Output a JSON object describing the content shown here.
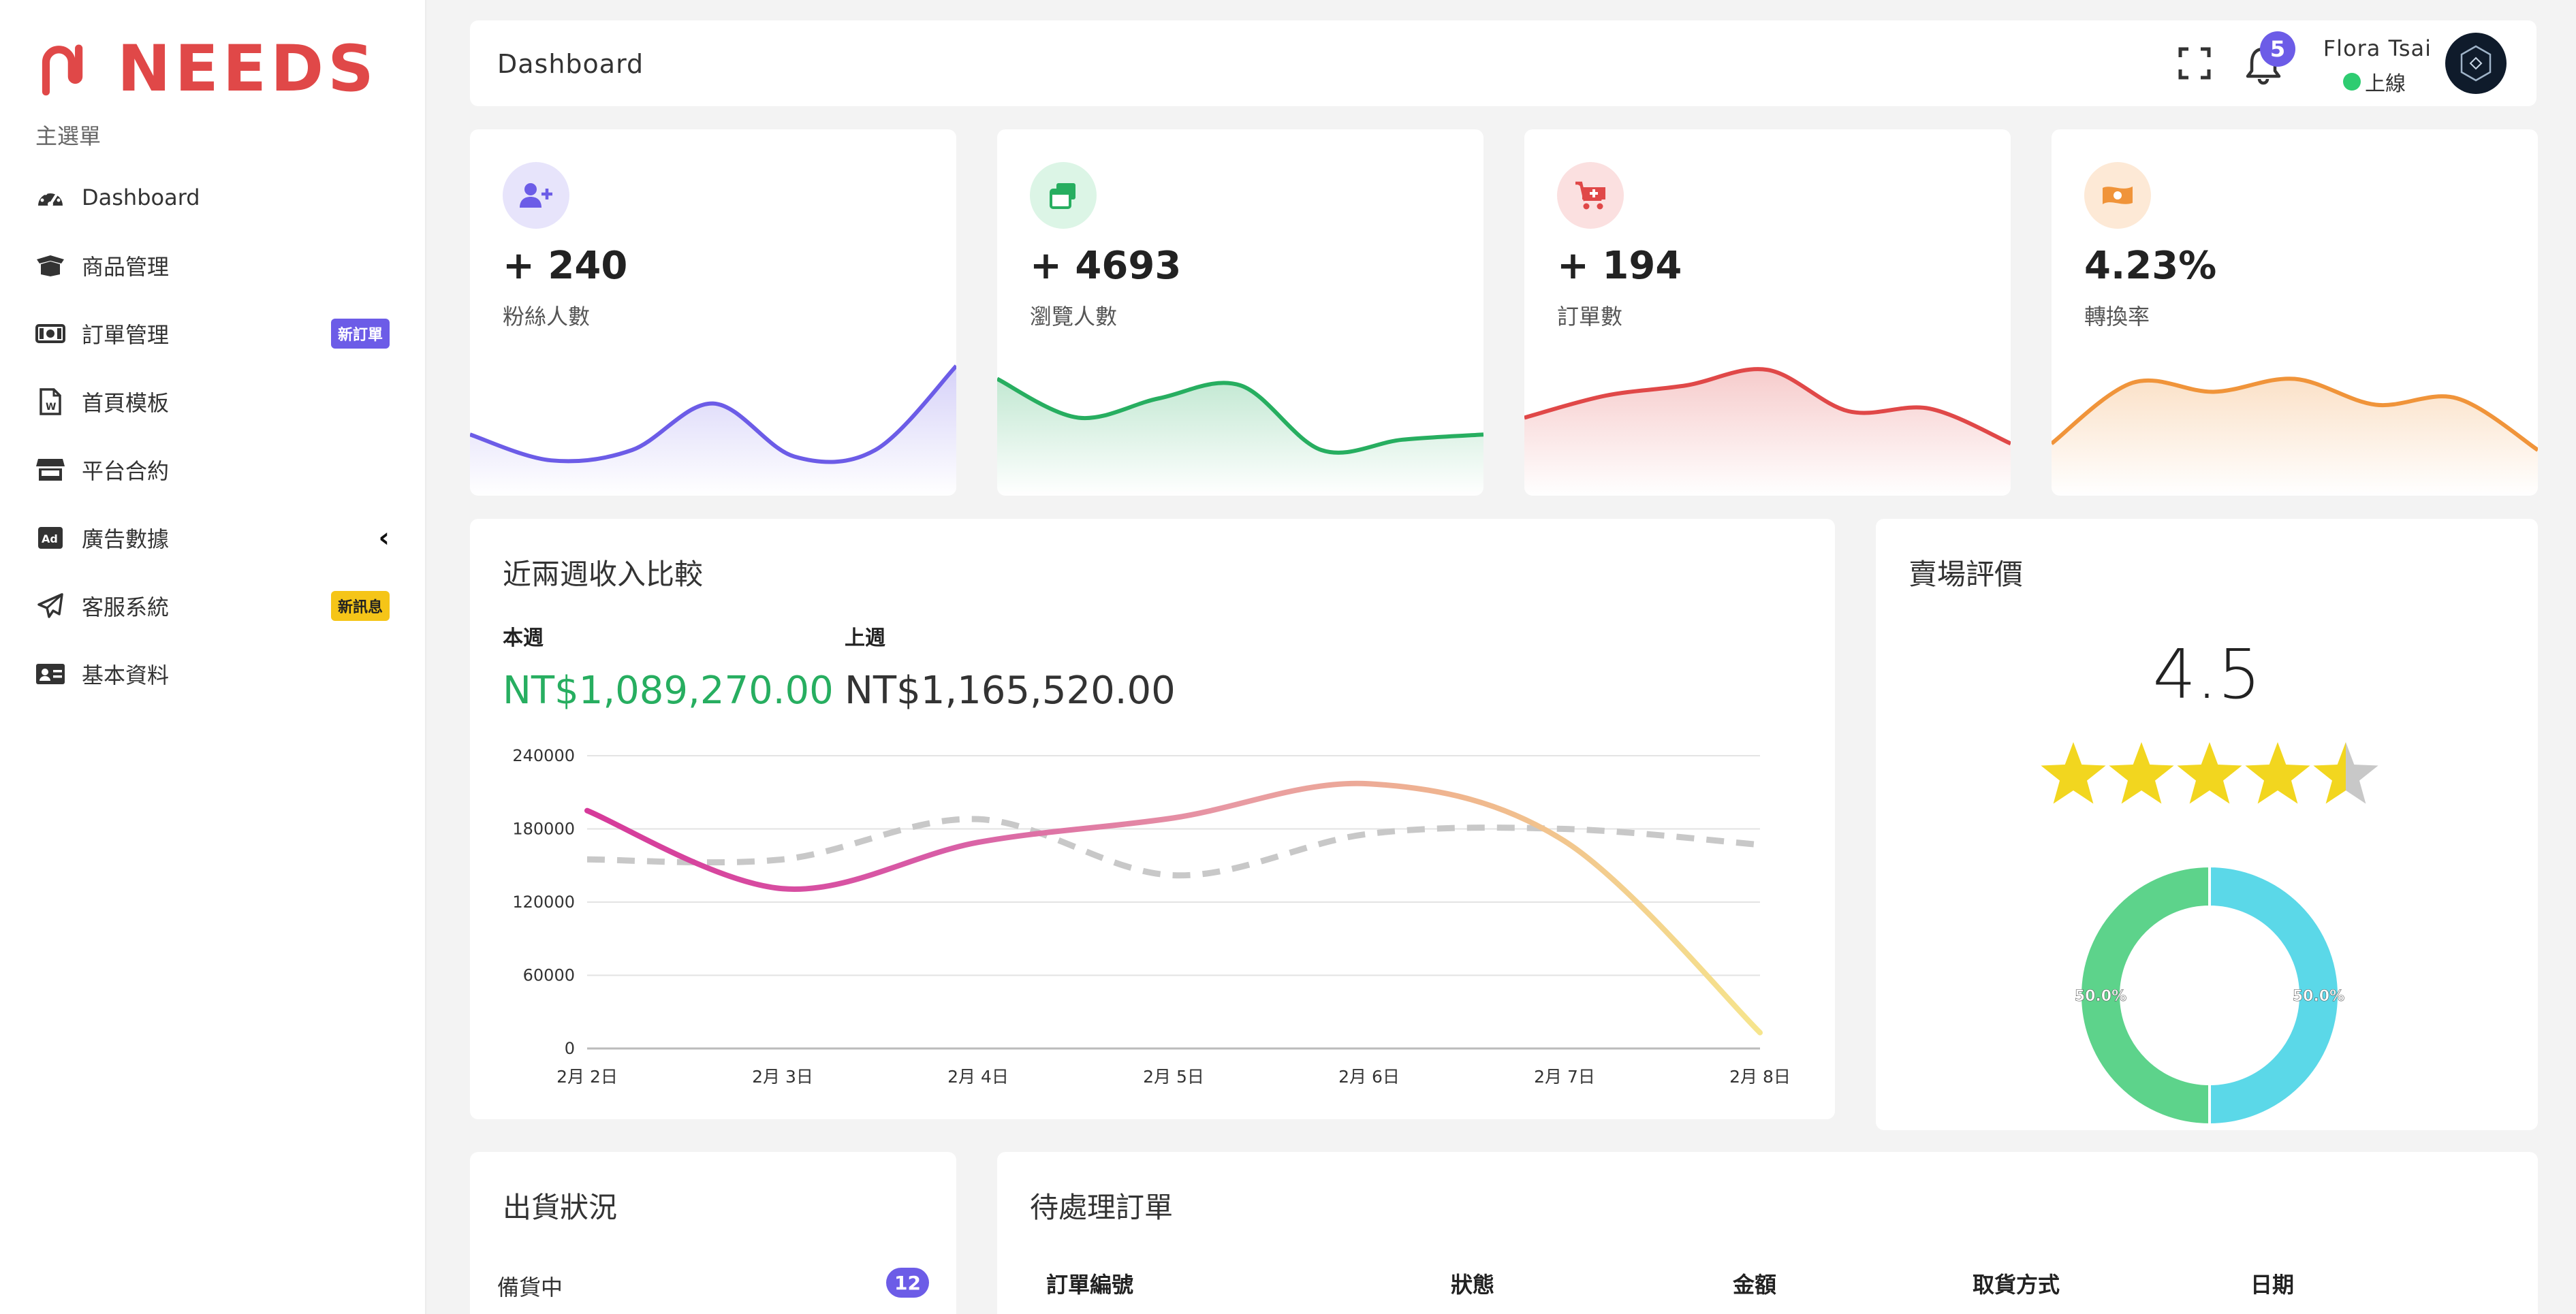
{
  "brand": {
    "name": "NEEDS",
    "color": "#e04848"
  },
  "sidebar": {
    "menu_title": "主選單",
    "items": [
      {
        "label": "Dashboard",
        "icon": "gauge-icon"
      },
      {
        "label": "商品管理",
        "icon": "box-open-icon"
      },
      {
        "label": "訂單管理",
        "icon": "money-bill-icon",
        "badge": "新訂單"
      },
      {
        "label": "首頁模板",
        "icon": "word-file-icon"
      },
      {
        "label": "平台合約",
        "icon": "store-icon"
      },
      {
        "label": "廣告數據",
        "icon": "ad-icon",
        "chevron": "chevron-left-icon"
      },
      {
        "label": "客服系統",
        "icon": "paper-plane-icon",
        "badge": "新訊息"
      },
      {
        "label": "基本資料",
        "icon": "id-card-icon"
      }
    ]
  },
  "header": {
    "title": "Dashboard",
    "notification_count": "5",
    "user_name": "Flora Tsai",
    "user_status": "上線"
  },
  "stats": [
    {
      "value": "+ 240",
      "label": "粉絲人數",
      "icon": "user-plus-icon",
      "color": "#6c5ce7",
      "bg": "#e7e4fb"
    },
    {
      "value": "+ 4693",
      "label": "瀏覽人數",
      "icon": "window-restore-icon",
      "color": "#27ae60",
      "bg": "#dcf5e6"
    },
    {
      "value": "+ 194",
      "label": "訂單數",
      "icon": "cart-plus-icon",
      "color": "#e04848",
      "bg": "#fbe0e0"
    },
    {
      "value": "4.23%",
      "label": "轉換率",
      "icon": "money-bill-wave-icon",
      "color": "#f0943a",
      "bg": "#fde9d6"
    }
  ],
  "revenue": {
    "title": "近兩週收入比較",
    "this_week_label": "本週",
    "this_week_value": "NT$1,089,270.00",
    "last_week_label": "上週",
    "last_week_value": "NT$1,165,520.00"
  },
  "rating": {
    "title": "賣場評價",
    "value": "4.5",
    "stars": 4.5,
    "donut_labels": [
      "50.0%",
      "50.0%"
    ]
  },
  "shipping": {
    "title": "出貨狀況",
    "rows": [
      {
        "label": "備貨中",
        "count": "12"
      }
    ]
  },
  "orders": {
    "title": "待處理訂單",
    "columns": [
      "訂單編號",
      "狀態",
      "金額",
      "取貨方式",
      "日期"
    ]
  },
  "chart_data": [
    {
      "type": "area",
      "title": "",
      "series": [
        {
          "values": [
            0.42,
            0.22,
            0.3,
            0.66,
            0.25,
            0.3,
            0.95
          ]
        }
      ]
    },
    {
      "type": "area",
      "title": "",
      "series": [
        {
          "values": [
            0.85,
            0.55,
            0.7,
            0.8,
            0.3,
            0.38,
            0.42
          ]
        }
      ]
    },
    {
      "type": "area",
      "title": "",
      "series": [
        {
          "values": [
            0.55,
            0.72,
            0.8,
            0.92,
            0.6,
            0.62,
            0.35
          ]
        }
      ]
    },
    {
      "type": "area",
      "title": "",
      "series": [
        {
          "values": [
            0.35,
            0.82,
            0.75,
            0.85,
            0.65,
            0.7,
            0.3
          ]
        }
      ]
    },
    {
      "type": "line",
      "title": "",
      "xlabel": "",
      "ylabel": "",
      "categories": [
        "2月 2日",
        "2月 3日",
        "2月 4日",
        "2月 5日",
        "2月 6日",
        "2月 7日",
        "2月 8日"
      ],
      "yticks": [
        0,
        60000,
        120000,
        180000,
        240000
      ],
      "ylim": [
        0,
        240000
      ],
      "grid": true,
      "series": [
        {
          "values": [
            195000,
            131000,
            169000,
            189000,
            217000,
            170000,
            13000
          ]
        },
        {
          "values": [
            155000,
            155000,
            188000,
            142000,
            176000,
            180000,
            167000
          ]
        }
      ]
    },
    {
      "type": "pie",
      "title": "",
      "categories": [
        "",
        ""
      ],
      "values": [
        50.0,
        50.0
      ],
      "colors": [
        "#5bd8e8",
        "#5dd38b"
      ]
    }
  ]
}
